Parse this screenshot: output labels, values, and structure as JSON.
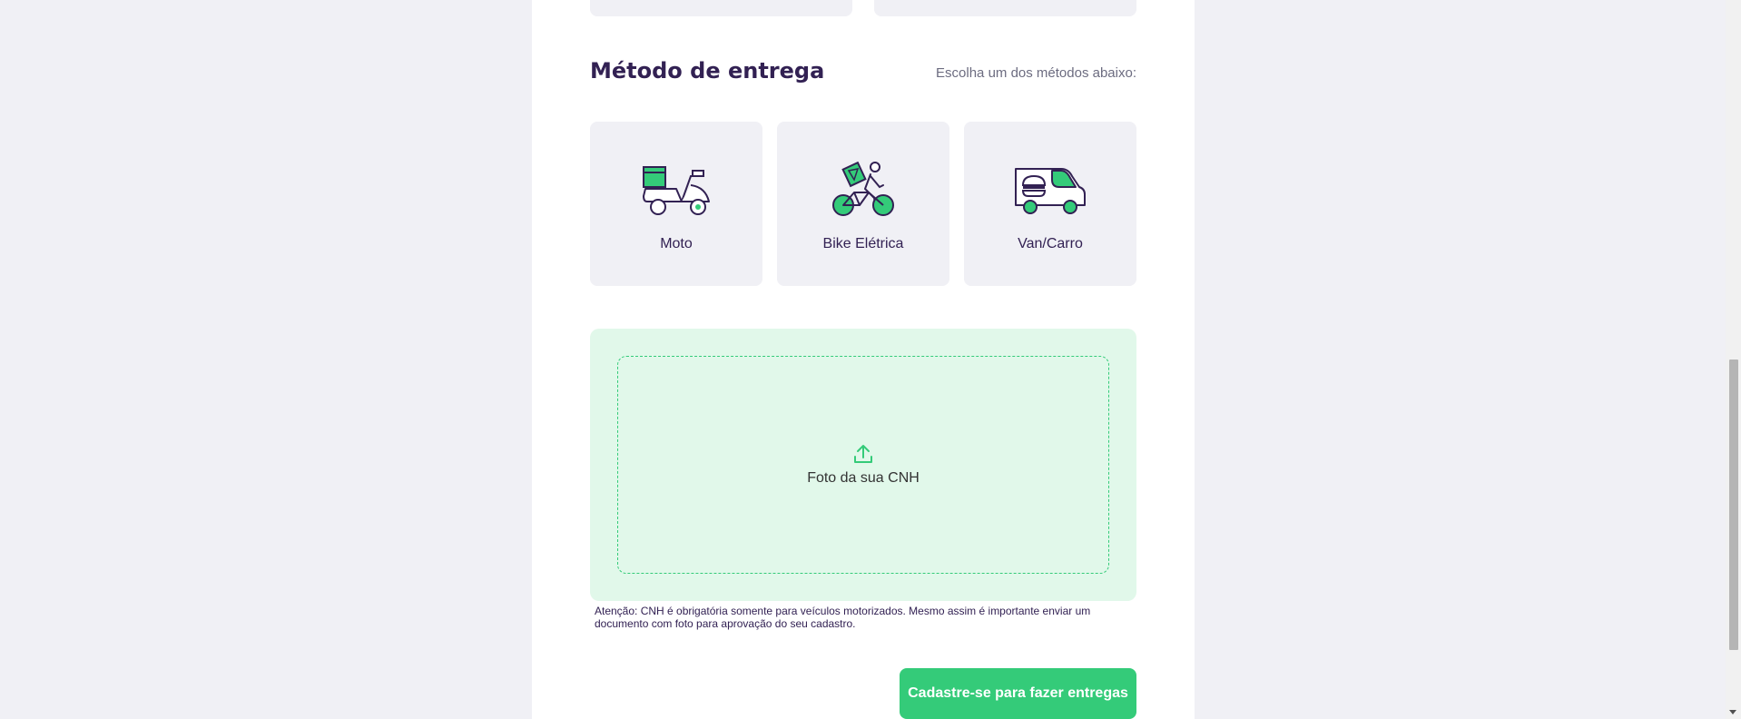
{
  "section": {
    "title": "Método de entrega",
    "hint": "Escolha um dos métodos abaixo:"
  },
  "methods": [
    {
      "label": "Moto",
      "icon": "scooter-icon"
    },
    {
      "label": "Bike Elétrica",
      "icon": "electric-bike-icon"
    },
    {
      "label": "Van/Carro",
      "icon": "van-icon"
    }
  ],
  "upload": {
    "label": "Foto da sua CNH",
    "icon": "upload-icon"
  },
  "notice": "Atenção: CNH é obrigatória somente para veículos motorizados. Mesmo assim é importante enviar um documento com foto para aprovação do seu cadastro.",
  "submit_label": "Cadastre-se para fazer entregas",
  "colors": {
    "accent": "#34cb79",
    "title": "#322153",
    "dropzone_bg": "#e1f8ea"
  }
}
